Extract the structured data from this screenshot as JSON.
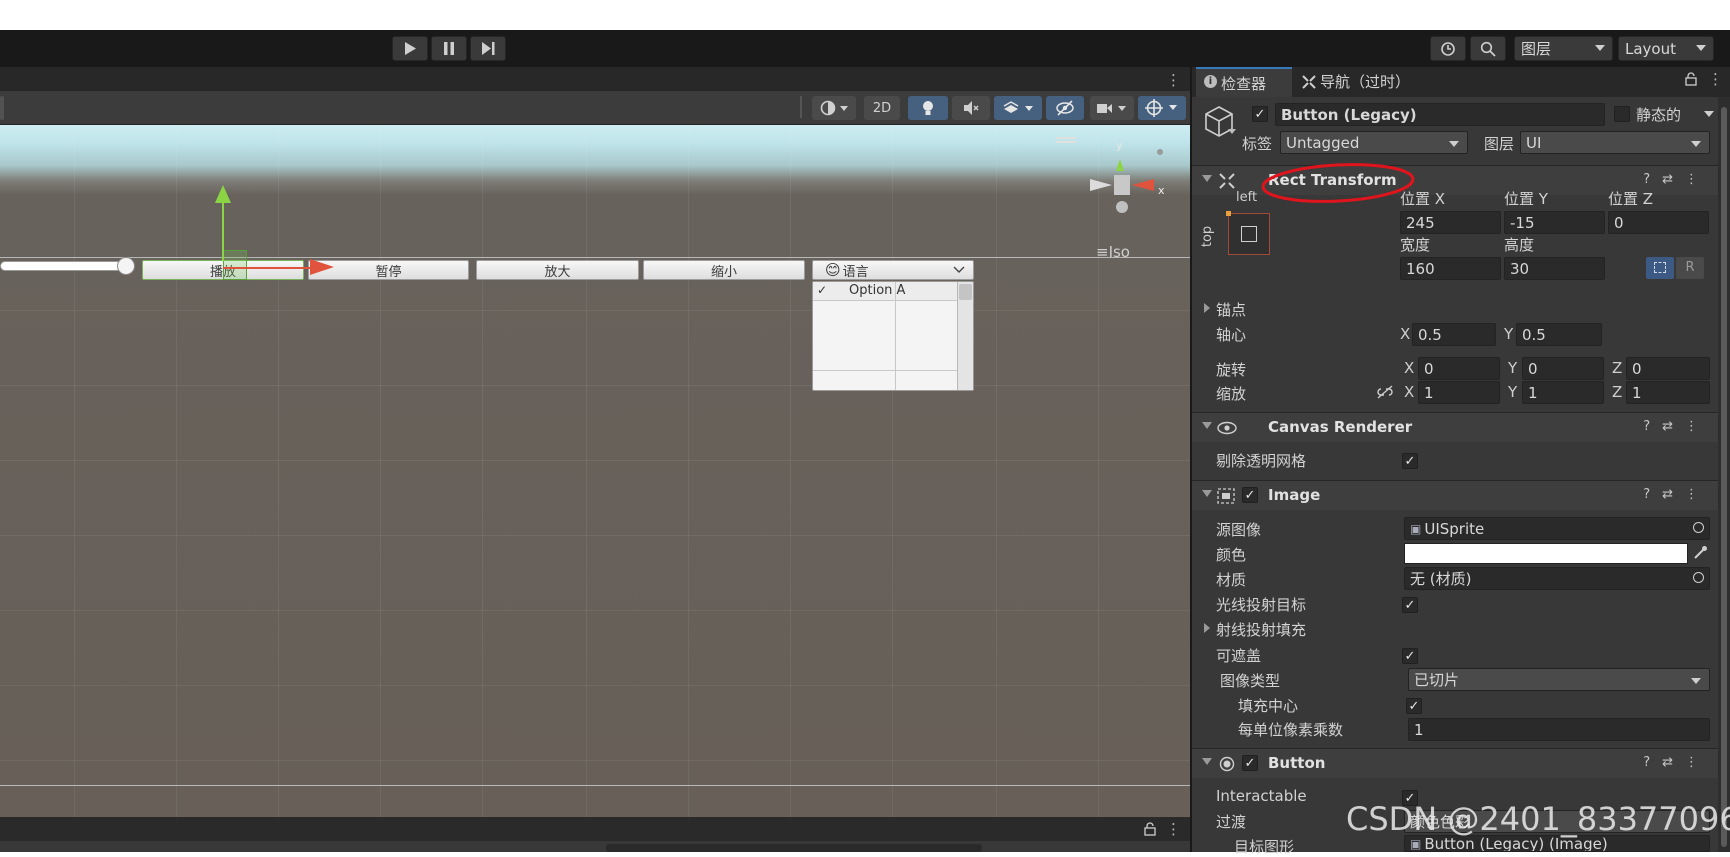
{
  "toolbar": {
    "layers_dropdown": "图层",
    "layout_dropdown": "Layout"
  },
  "scene": {
    "toolbar": {
      "mode_2d": "2D"
    },
    "iso_label": "≡Iso",
    "buttons": [
      {
        "label": "播放"
      },
      {
        "label": "暂停"
      },
      {
        "label": "放大"
      },
      {
        "label": "缩小"
      }
    ],
    "dropdown": {
      "emoji": "😊",
      "label": "语言",
      "option": "Option A"
    },
    "gizmo_labels": {
      "x": "x",
      "y": "y"
    }
  },
  "inspector": {
    "tabs": [
      {
        "label": "检查器"
      },
      {
        "label": "导航（过时）"
      }
    ],
    "object": {
      "name": "Button (Legacy)",
      "static_label": "静态的",
      "tag_label": "标签",
      "tag_value": "Untagged",
      "layer_label": "图层",
      "layer_value": "UI"
    },
    "rect_transform": {
      "title": "Rect Transform",
      "anchor_h": "left",
      "anchor_v": "top",
      "pos_x_label": "位置 X",
      "pos_y_label": "位置 Y",
      "pos_z_label": "位置 Z",
      "pos_x": "245",
      "pos_y": "-15",
      "pos_z": "0",
      "width_label": "宽度",
      "height_label": "高度",
      "width": "160",
      "height": "30",
      "r_button": "R",
      "anchors_label": "锚点",
      "pivot_label": "轴心",
      "pivot_x": "0.5",
      "pivot_y": "0.5",
      "rotation_label": "旋转",
      "rot_x": "0",
      "rot_y": "0",
      "rot_z": "0",
      "scale_label": "缩放",
      "scale_x": "1",
      "scale_y": "1",
      "scale_z": "1",
      "x": "X",
      "y": "Y",
      "z": "Z"
    },
    "canvas_renderer": {
      "title": "Canvas Renderer",
      "cull_label": "剔除透明网格"
    },
    "image": {
      "title": "Image",
      "source_label": "源图像",
      "source_value": "UISprite",
      "color_label": "颜色",
      "material_label": "材质",
      "material_value": "无 (材质)",
      "raycast_target_label": "光线投射目标",
      "raycast_padding_label": "射线投射填充",
      "maskable_label": "可遮盖",
      "image_type_label": "图像类型",
      "image_type_value": "已切片",
      "fill_center_label": "填充中心",
      "ppu_label": "每单位像素乘数",
      "ppu_value": "1"
    },
    "button": {
      "title": "Button",
      "interactable_label": "Interactable",
      "transition_label": "过渡",
      "transition_value": "颜色色彩",
      "target_graphic_label": "目标图形",
      "target_graphic_value": "Button (Legacy) (Image)"
    }
  },
  "watermark": "CSDN @2401_83377096",
  "colors": {
    "accent_blue": "#3d5a85",
    "annotation_red": "#e0141c",
    "gizmo_green": "#8bd545",
    "gizmo_red": "#e0533c"
  }
}
